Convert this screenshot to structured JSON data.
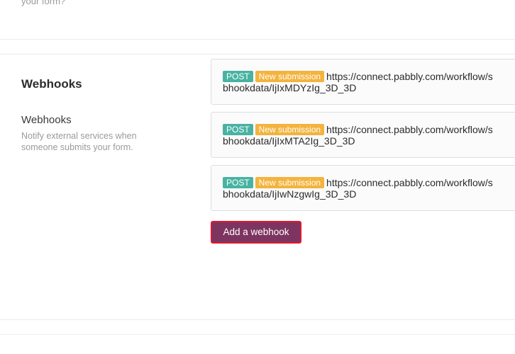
{
  "previous_section": {
    "desc_tail": "your form?"
  },
  "webhooks_section": {
    "title": "Webhooks",
    "field_label": "Webhooks",
    "field_description": "Notify external services when someone submits your form.",
    "webhooks": [
      {
        "method": "POST",
        "event": "New submission",
        "url_line1": "https://connect.pabbly.com/workflow/s",
        "url_line2": "bhookdata/IjIxMDYzIg_3D_3D"
      },
      {
        "method": "POST",
        "event": "New submission",
        "url_line1": "https://connect.pabbly.com/workflow/s",
        "url_line2": "bhookdata/IjIxMTA2Ig_3D_3D"
      },
      {
        "method": "POST",
        "event": "New submission",
        "url_line1": "https://connect.pabbly.com/workflow/s",
        "url_line2": "bhookdata/IjIwNzgwIg_3D_3D"
      }
    ],
    "add_button_label": "Add a webhook"
  },
  "colors": {
    "post_badge": "#48b3a2",
    "event_badge": "#f3b33d",
    "add_button": "#7d3460",
    "add_button_outline": "#e0182d"
  }
}
